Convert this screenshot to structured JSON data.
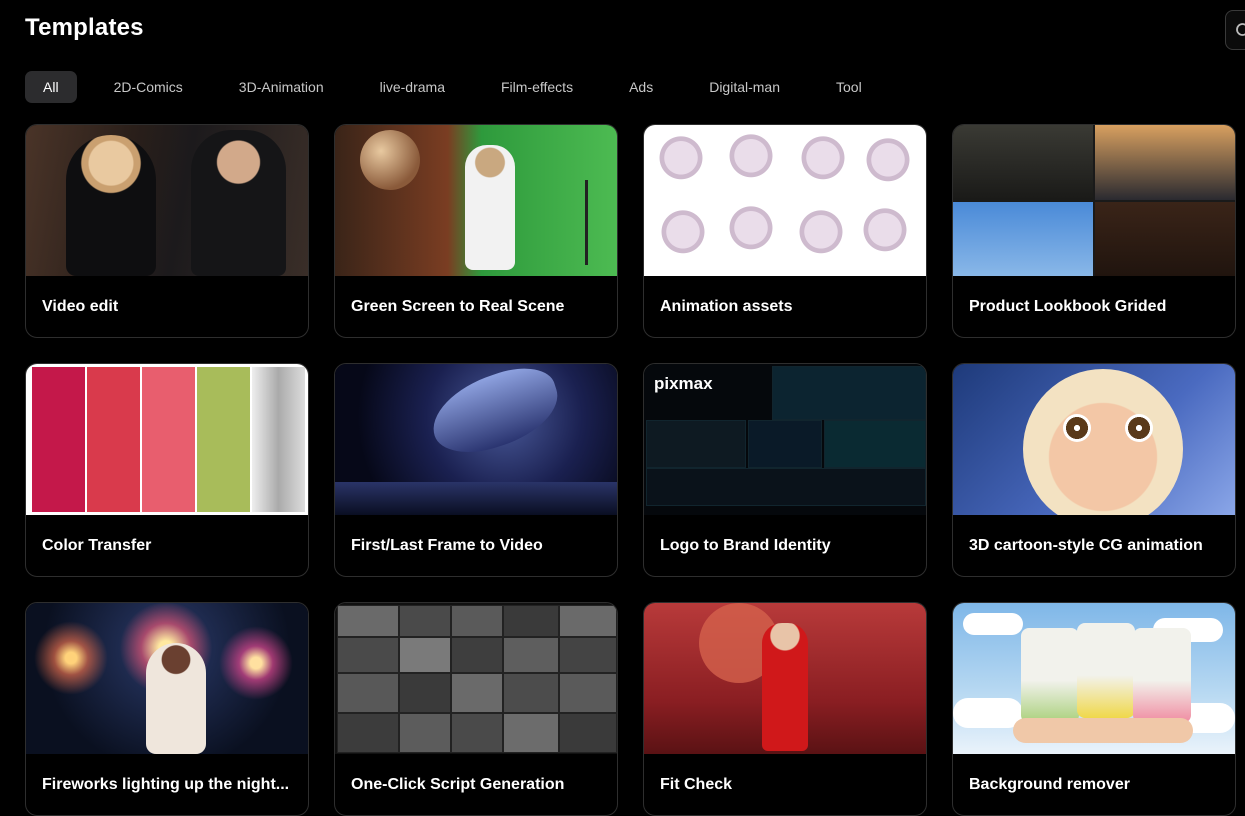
{
  "page": {
    "title": "Templates"
  },
  "search": {
    "icon": "search-icon"
  },
  "tabs": [
    {
      "label": "All",
      "active": true
    },
    {
      "label": "2D-Comics",
      "active": false
    },
    {
      "label": "3D-Animation",
      "active": false
    },
    {
      "label": "live-drama",
      "active": false
    },
    {
      "label": "Film-effects",
      "active": false
    },
    {
      "label": "Ads",
      "active": false
    },
    {
      "label": "Digital-man",
      "active": false
    },
    {
      "label": "Tool",
      "active": false
    }
  ],
  "templates": [
    {
      "label": "Video edit"
    },
    {
      "label": "Green Screen to Real Scene"
    },
    {
      "label": "Animation assets"
    },
    {
      "label": "Product Lookbook Grided"
    },
    {
      "label": "Color Transfer"
    },
    {
      "label": "First/Last Frame to Video"
    },
    {
      "label": "Logo to Brand Identity",
      "thumb_brand": "pixmax"
    },
    {
      "label": "3D cartoon-style CG animation"
    },
    {
      "label": "Fireworks lighting up the night..."
    },
    {
      "label": "One-Click Script Generation"
    },
    {
      "label": "Fit Check"
    },
    {
      "label": "Background remover"
    }
  ],
  "colors": {
    "background": "#000000",
    "active_tab": "#2c2c2e",
    "swatches": [
      "#c4184a",
      "#d93a4c",
      "#e85e6e",
      "#a8bc5a",
      "#c8c8c8"
    ]
  }
}
